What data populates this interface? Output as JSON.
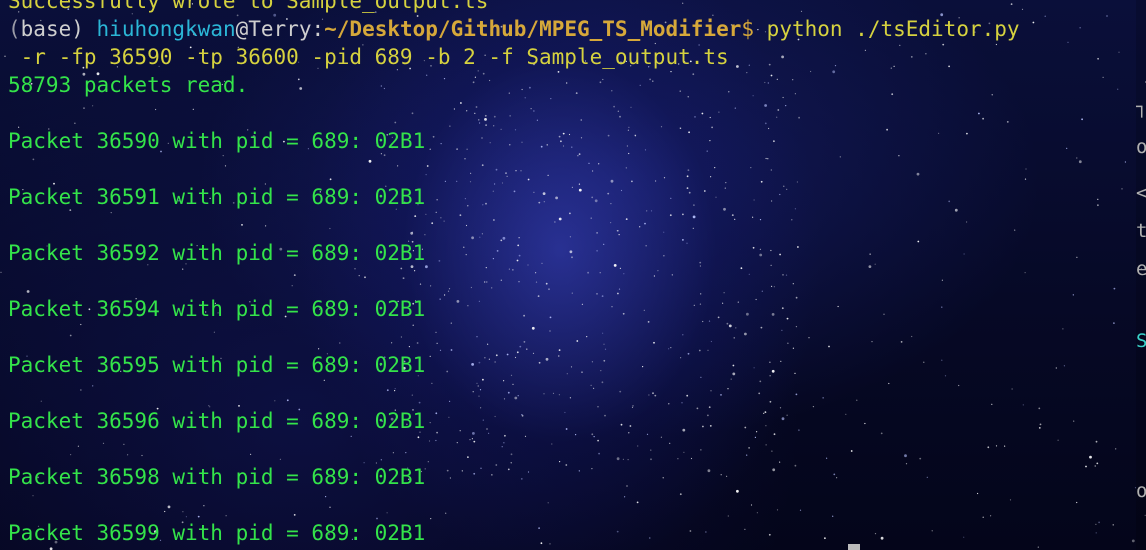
{
  "terminal": {
    "scrolled_line": "Successfully wrote to Sample_output.ts",
    "prompt": {
      "open_bracket": "(",
      "env": "base",
      "close_bracket": ") ",
      "user": "hiuhongkwan",
      "at": "@",
      "host": "Terry",
      "colon": ":",
      "path": "~/Desktop/Github/MPEG_TS_Modifier",
      "dollar": "$ ",
      "command_part1": "python ./tsEditor.py",
      "command_part2": " -r -fp 36590 -tp 36600 -pid 689 -b 2 -f Sample_output.ts"
    },
    "read_summary": "58793 packets read.",
    "packets": [
      "Packet 36590 with pid = 689: 02B1",
      "Packet 36591 with pid = 689: 02B1",
      "Packet 36592 with pid = 689: 02B1",
      "Packet 36594 with pid = 689: 02B1",
      "Packet 36595 with pid = 689: 02B1",
      "Packet 36596 with pid = 689: 02B1",
      "Packet 36598 with pid = 689: 02B1",
      "Packet 36599 with pid = 689: 02B1"
    ],
    "colors": {
      "output_green": "#34e44a",
      "command_yellow": "#d6d23f",
      "user_cyan": "#2bb6d6",
      "path_orange": "#d6a83a",
      "background": "#060926"
    }
  }
}
